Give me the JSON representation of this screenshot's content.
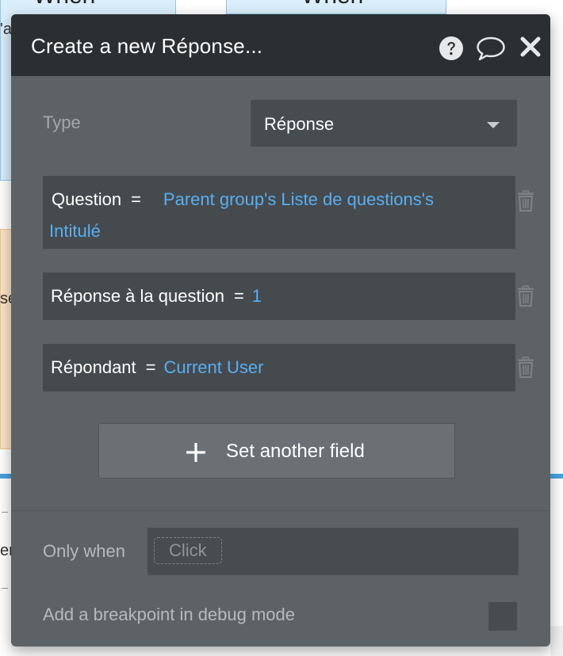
{
  "background": {
    "when_left": "When",
    "when_right": "When",
    "fragment_a": "'a",
    "fragment_se": "se",
    "fragment_er": "er"
  },
  "modal": {
    "title": "Create a new Réponse...",
    "icons": {
      "help": "question-circle-icon",
      "comment": "speech-bubble-icon",
      "close": "close-icon"
    },
    "type_label": "Type",
    "type_value": "Réponse",
    "fields": [
      {
        "name": "Question",
        "eq": "=",
        "value_line1": "Parent group's Liste de questions's",
        "value_line2": "Intitulé"
      },
      {
        "name": "Réponse à la question",
        "eq": "=",
        "value": "1"
      },
      {
        "name": "Répondant",
        "eq": "=",
        "value": "Current User"
      }
    ],
    "set_another_field": "Set another field",
    "only_when_label": "Only when",
    "only_when_placeholder": "Click",
    "breakpoint_label": "Add a breakpoint in debug mode"
  },
  "colors": {
    "header_bg": "#2b2f32",
    "modal_bg": "#5d6266",
    "field_bg": "#454a4e",
    "value_blue": "#5aaef0"
  }
}
